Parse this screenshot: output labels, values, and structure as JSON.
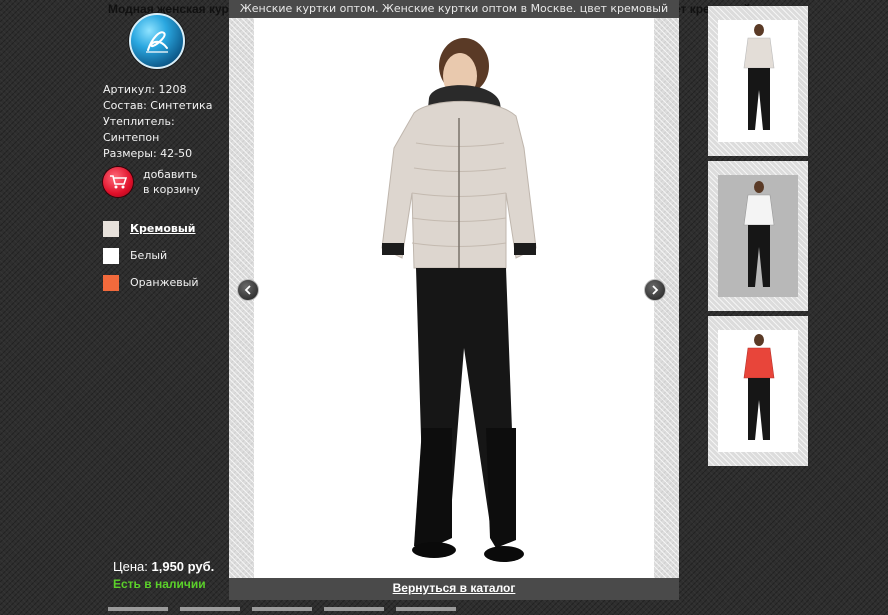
{
  "header": {
    "title": "Модная женская куртка оптом от производителя. Женские куртки оптом. Пуховик (женский) цвет кремовый оптом"
  },
  "product": {
    "article": "Артикул: 1208",
    "composition": "Состав: Синтетика",
    "insulation_label": "Утеплитель:",
    "insulation_value": "Синтепон",
    "sizes": "Размеры: 42-50",
    "add_to_cart_line1": "добавить",
    "add_to_cart_line2": "в корзину",
    "price_label": "Цена:",
    "price_value": "1,950 руб.",
    "stock": "Есть в наличии"
  },
  "colors": [
    {
      "label": "Кремовый",
      "hex": "#e8e2dc",
      "active": true
    },
    {
      "label": "Белый",
      "hex": "#ffffff",
      "active": false
    },
    {
      "label": "Оранжевый",
      "hex": "#f26a3c",
      "active": false
    }
  ],
  "lightbox": {
    "caption": "Женские куртки оптом. Женские куртки оптом в Москве. цвет кремовый",
    "back_link": "Вернуться в каталог",
    "icons": [
      "chevron-left-icon",
      "chevron-right-icon"
    ]
  },
  "thumbnails": [
    {
      "jacket": "#e3ddd7"
    },
    {
      "jacket": "#f4f4f4"
    },
    {
      "jacket": "#e8453a"
    }
  ],
  "accent_colors": {
    "stock": "#5bd02a",
    "cart": "#e0102a",
    "logo": "#2aa7e0"
  }
}
